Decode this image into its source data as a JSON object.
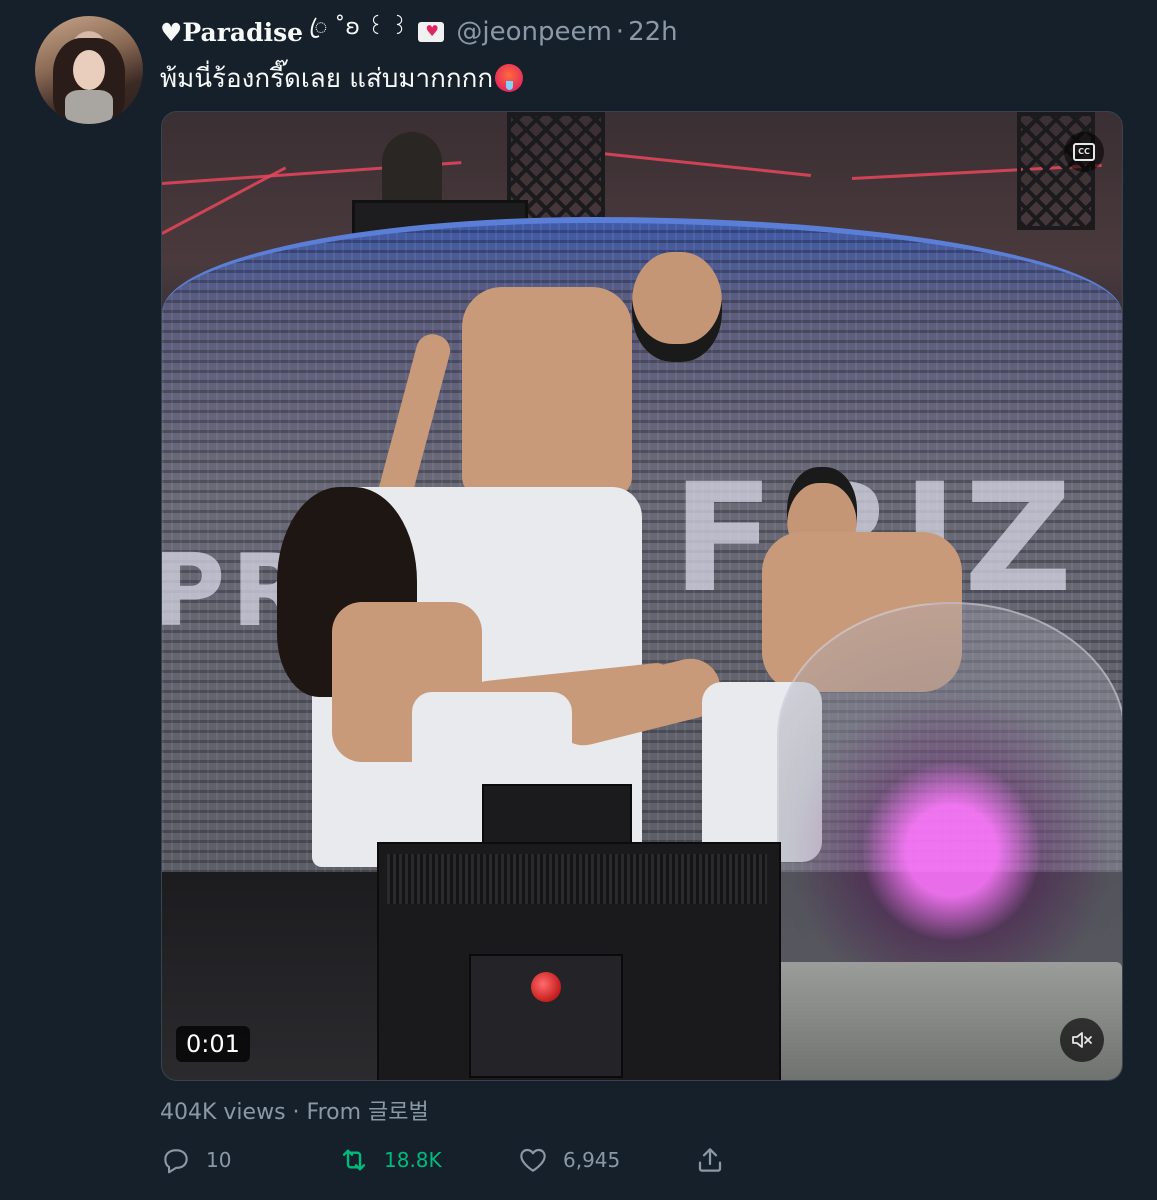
{
  "author": {
    "display_name": "Paradise",
    "name_decoration": "ꦿ ˚ʚ ꒰ ꒱",
    "handle": "@jeonpeem",
    "time_ago": "22h"
  },
  "tweet": {
    "text": "พ้มนี่ร้องกรี๊ดเลย แส่บมากกกก"
  },
  "media": {
    "type": "video",
    "timestamp": "0:01",
    "wall_text_left": "PRIZ",
    "wall_text_right": "FRIZ"
  },
  "meta": {
    "views": "404K views",
    "separator": " · ",
    "source": "From 글로벌"
  },
  "actions": {
    "reply_count": "10",
    "retweet_count": "18.8K",
    "like_count": "6,945"
  },
  "colors": {
    "background": "#15202b",
    "text_primary": "#f7f9f9",
    "text_secondary": "#8b98a5",
    "retweet_green": "#00ba7c"
  }
}
